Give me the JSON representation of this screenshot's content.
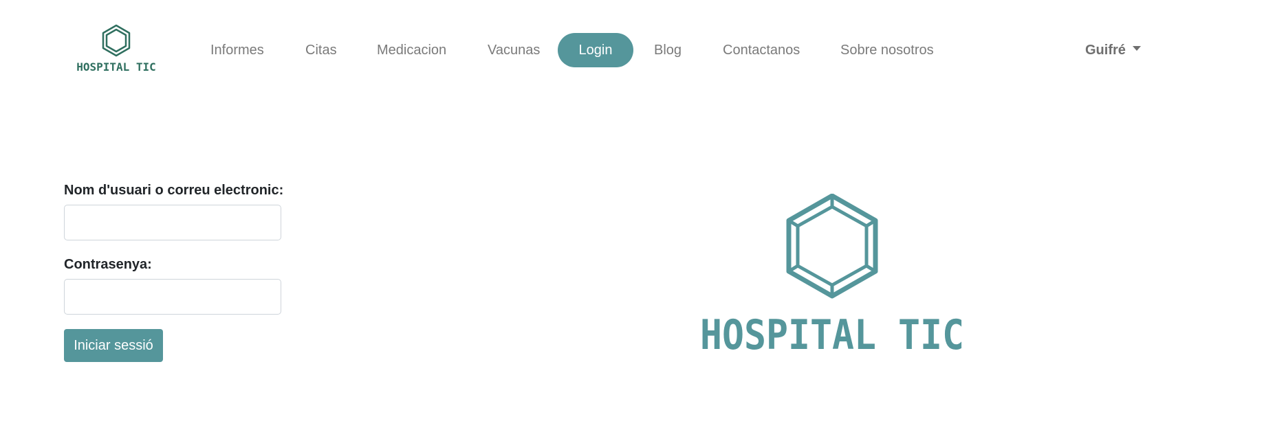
{
  "brand": {
    "name": "HOSPITAL TIC",
    "color": "#2f6f5f"
  },
  "nav": {
    "items": [
      {
        "label": "Informes"
      },
      {
        "label": "Citas"
      },
      {
        "label": "Medicacion"
      },
      {
        "label": "Vacunas"
      },
      {
        "label": "Login",
        "active": true
      },
      {
        "label": "Blog"
      },
      {
        "label": "Contactanos"
      },
      {
        "label": "Sobre nosotros"
      }
    ],
    "user": {
      "name": "Guifré"
    }
  },
  "login_form": {
    "username_label": "Nom d'usuari o correu electronic:",
    "username_value": "",
    "password_label": "Contrasenya:",
    "password_value": "",
    "submit_label": "Iniciar sessió"
  },
  "hero": {
    "logo_text": "HOSPITAL TIC",
    "color": "#55969b"
  },
  "colors": {
    "accent": "#55969b",
    "nav_text": "#7a7a7a",
    "brand_green": "#2f6f5f"
  }
}
